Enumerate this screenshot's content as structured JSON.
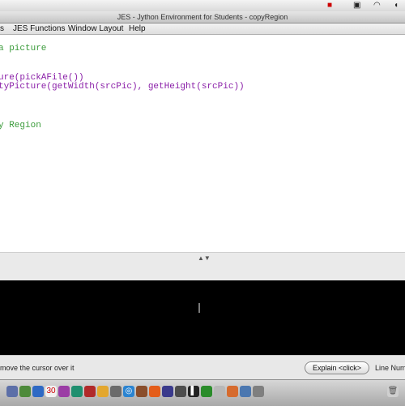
{
  "window": {
    "title": "JES - Jython Environment for Students - copyRegion"
  },
  "menu": {
    "items": [
      "s",
      "JES Functions",
      "Window Layout",
      "Help"
    ]
  },
  "editor": {
    "lines": [
      "a picture",
      "ure(pickAFile())",
      "tyPicture(getWidth(srcPic), getHeight(srcPic))",
      "y Region"
    ]
  },
  "status": {
    "hint": "move the cursor over it",
    "explain_label": "Explain <click>",
    "line_number_label": "Line Num"
  },
  "system": {
    "menubar_icons": [
      "flag-icon",
      "control-icon",
      "wifi-icon",
      "volume-icon"
    ]
  },
  "dock": {
    "icons": [
      "app-1",
      "app-2",
      "app-3",
      "calendar-icon",
      "app-5",
      "app-6",
      "app-7",
      "app-8",
      "app-9",
      "safari-icon",
      "app-11",
      "firefox-icon",
      "app-13",
      "app-14",
      "terminal-icon",
      "app-16",
      "app-17",
      "app-18",
      "app-19",
      "app-20",
      "trash-icon"
    ]
  }
}
